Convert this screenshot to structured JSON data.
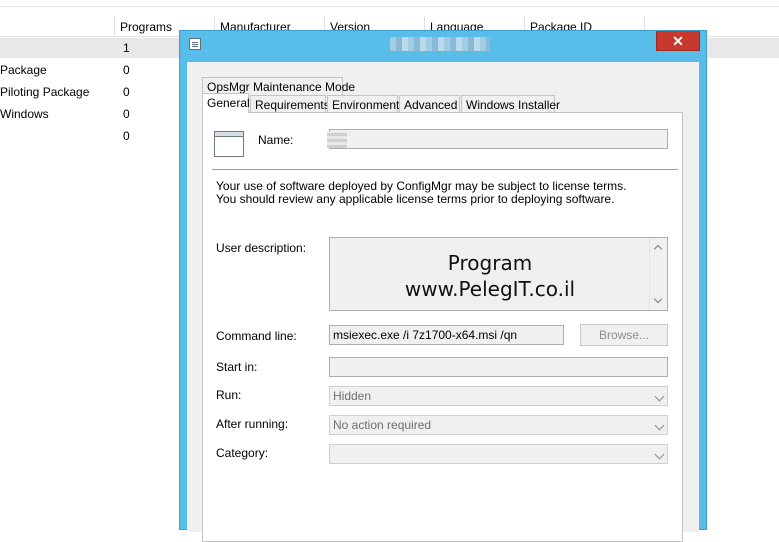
{
  "background_list": {
    "columns": [
      "Programs",
      "Manufacturer",
      "Version",
      "Language",
      "Package ID"
    ],
    "rows": [
      {
        "name": "",
        "programs": "1"
      },
      {
        "name": "Package",
        "programs": "0"
      },
      {
        "name": "Piloting Package",
        "programs": "0"
      },
      {
        "name": "Windows",
        "programs": "0"
      },
      {
        "name": "",
        "programs": "0"
      }
    ]
  },
  "dialog": {
    "close_label": "✕",
    "tabs_row1": [
      "OpsMgr Maintenance Mode"
    ],
    "tabs_row2": [
      "General",
      "Requirements",
      "Environment",
      "Advanced",
      "Windows Installer"
    ],
    "general": {
      "name_label": "Name:",
      "name_value": "",
      "license_text": "Your use of software deployed by ConfigMgr may be subject to license terms. You should review any applicable license terms prior to deploying software.",
      "user_description_label": "User description:",
      "user_description_line1": "Program",
      "user_description_line2": "www.PelegIT.co.il",
      "command_line_label": "Command line:",
      "command_line_value": "msiexec.exe /i 7z1700-x64.msi /qn",
      "browse_label": "Browse...",
      "start_in_label": "Start in:",
      "start_in_value": "",
      "run_label": "Run:",
      "run_value": "Hidden",
      "after_running_label": "After running:",
      "after_running_value": "No action required",
      "category_label": "Category:",
      "category_value": ""
    }
  }
}
